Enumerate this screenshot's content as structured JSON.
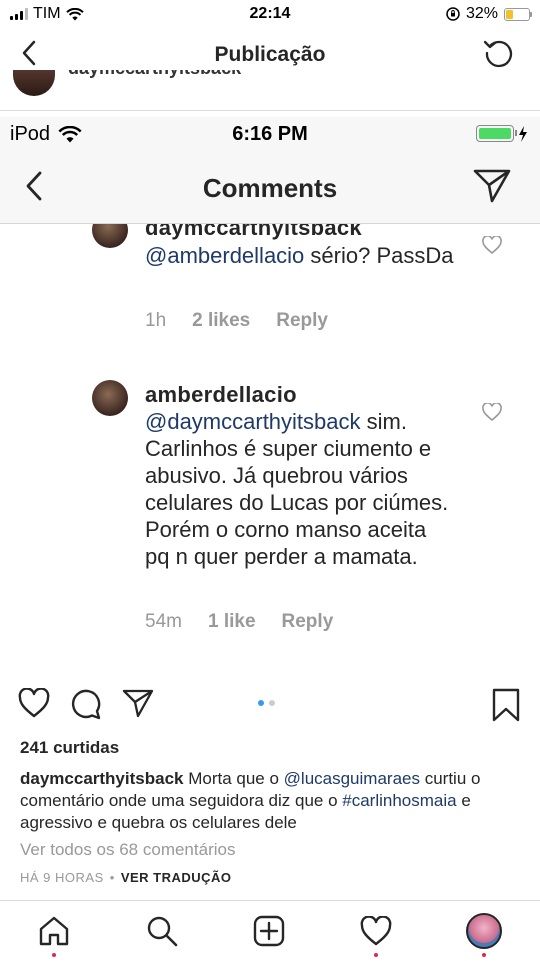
{
  "status_bar": {
    "carrier": "TIM",
    "time": "22:14",
    "battery": "32%",
    "battery_level": 0.32
  },
  "header": {
    "title": "Publicação"
  },
  "post_author_peek": "daymccarthyitsback",
  "embedded_screenshot": {
    "status_bar": {
      "device": "iPod",
      "time": "6:16 PM"
    },
    "header_title": "Comments",
    "comments": [
      {
        "username": "daymccarthyitsback",
        "mention": "@amberdellacio",
        "text": " sério? PassDa",
        "time": "1h",
        "likes": "2 likes",
        "reply": "Reply"
      },
      {
        "username": "amberdellacio",
        "mention": "@daymccarthyitsback",
        "text": " sim. Carlinhos é super ciumento e abusivo. Já quebrou vários celulares do Lucas por ciúmes. Porém o corno manso aceita pq n quer perder a mamata.",
        "time": "54m",
        "likes": "1 like",
        "reply": "Reply"
      }
    ]
  },
  "post": {
    "likes": "241 curtidas",
    "caption": {
      "username": "daymccarthyitsback",
      "text_1": " Morta que o ",
      "mention": "@lucasguimaraes",
      "text_2": " curtiu o comentário onde uma seguidora diz que o ",
      "hashtag": "#carlinhosmaia",
      "text_3": " e agressivo e quebra os celulares dele"
    },
    "view_all_comments": "Ver todos os 68 comentários",
    "time_ago": "HÁ 9 HORAS",
    "separator": "•",
    "translate": "VER TRADUÇÃO",
    "carousel": {
      "total": 2,
      "active": 1
    }
  },
  "tab_bar": [
    "home-icon",
    "search-icon",
    "add-icon",
    "activity-icon",
    "profile-avatar"
  ],
  "colors": {
    "link": "#1f3a68",
    "muted": "#999999",
    "active_dot": "#3897f0",
    "battery_outer": "#f2c12e",
    "battery_inner": "#4cd964",
    "notification_dot": "#e0245e"
  }
}
